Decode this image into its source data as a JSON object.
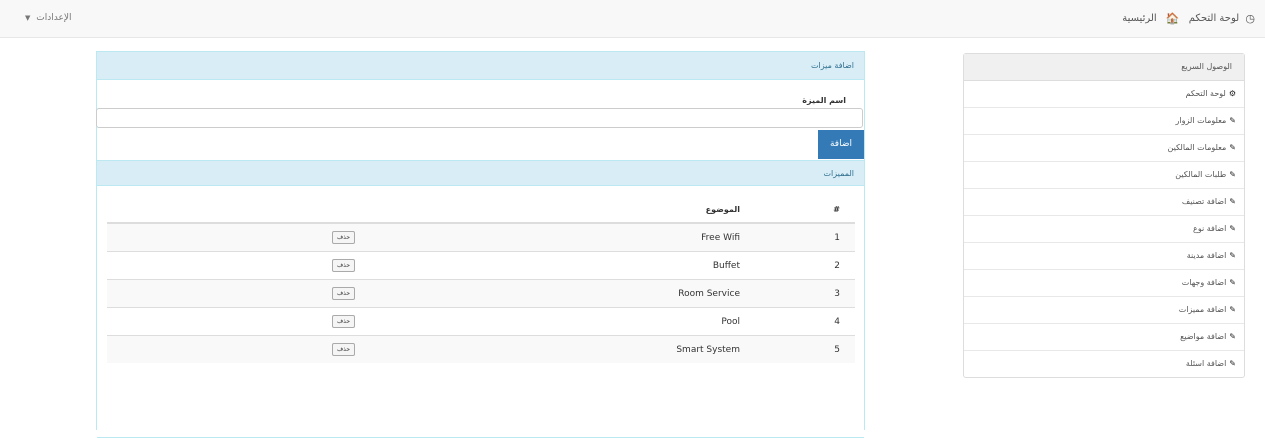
{
  "header": {
    "home_label": "الرئيسية",
    "dashboard_label": "لوحة التحكم",
    "settings_label": "الإعدادات"
  },
  "sidebar": {
    "title": "الوصول السريع",
    "items": [
      {
        "label": "لوحة التحكم",
        "icon": "dashboard-icon"
      },
      {
        "label": "معلومات الزوار",
        "icon": "pencil-icon"
      },
      {
        "label": "معلومات المالكين",
        "icon": "pencil-icon"
      },
      {
        "label": "طلبات المالكين",
        "icon": "pencil-icon"
      },
      {
        "label": "اضافة تصنيف",
        "icon": "pencil-icon"
      },
      {
        "label": "اضافة نوع",
        "icon": "pencil-icon"
      },
      {
        "label": "اضافة مدينة",
        "icon": "pencil-icon"
      },
      {
        "label": "اضافة وجهات",
        "icon": "pencil-icon"
      },
      {
        "label": "اضافة مميزات",
        "icon": "pencil-icon"
      },
      {
        "label": "اضافة مواضيع",
        "icon": "pencil-icon"
      },
      {
        "label": "اضافة اسئلة",
        "icon": "pencil-icon"
      }
    ]
  },
  "form": {
    "panel_title": "اضافة ميزات",
    "field_label": "اسم الميزة",
    "field_value": "",
    "field_placeholder": "",
    "submit_label": "اضافة"
  },
  "features": {
    "panel_title": "المميزات",
    "columns": [
      "#",
      "الموضوع",
      ""
    ],
    "delete_label": "حذف",
    "rows": [
      {
        "num": "1",
        "subject": "Free Wifi"
      },
      {
        "num": "2",
        "subject": "Buffet"
      },
      {
        "num": "3",
        "subject": "Room Service"
      },
      {
        "num": "4",
        "subject": "Pool"
      },
      {
        "num": "5",
        "subject": "Smart System"
      }
    ]
  },
  "colors": {
    "panel_header_bg": "#d9edf7",
    "panel_border": "#bce8f1",
    "primary_button": "#337ab7",
    "navbar_bg": "#f8f8f8"
  }
}
